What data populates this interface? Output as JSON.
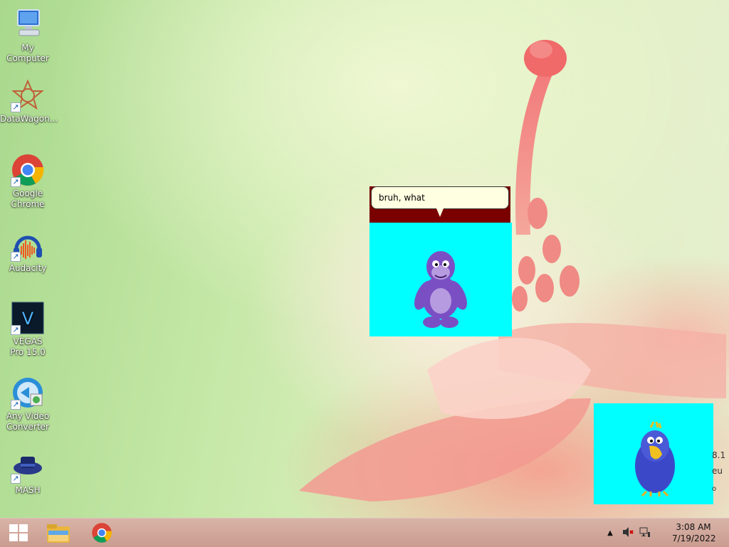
{
  "desktop": {
    "icons": [
      {
        "label": "My Computer",
        "icon": "computer-icon"
      },
      {
        "label": "DataWagon...",
        "icon": "datawagon-icon"
      },
      {
        "label": "Google Chrome",
        "icon": "chrome-icon"
      },
      {
        "label": "Audacity",
        "icon": "audacity-icon"
      },
      {
        "label": "VEGAS Pro 15.0",
        "icon": "vegas-icon"
      },
      {
        "label": "Any Video Converter",
        "icon": "video-converter-icon"
      },
      {
        "label": "MASH",
        "icon": "mash-icon"
      }
    ],
    "side_text": [
      "8.1",
      "eu",
      "o"
    ]
  },
  "bonzi": {
    "speech": "bruh, what"
  },
  "taskbar": {
    "start_icon": "windows-start-icon",
    "pinned": [
      "file-explorer-icon",
      "chrome-icon"
    ],
    "tray_icons": [
      "show-hidden-icons-icon",
      "volume-muted-icon",
      "network-icon"
    ],
    "time": "3:08 AM",
    "date": "7/19/2022"
  },
  "colors": {
    "agent_bg": "#00ffff",
    "bubble_band": "#7a0000",
    "bubble_bg": "#ffffe1"
  }
}
